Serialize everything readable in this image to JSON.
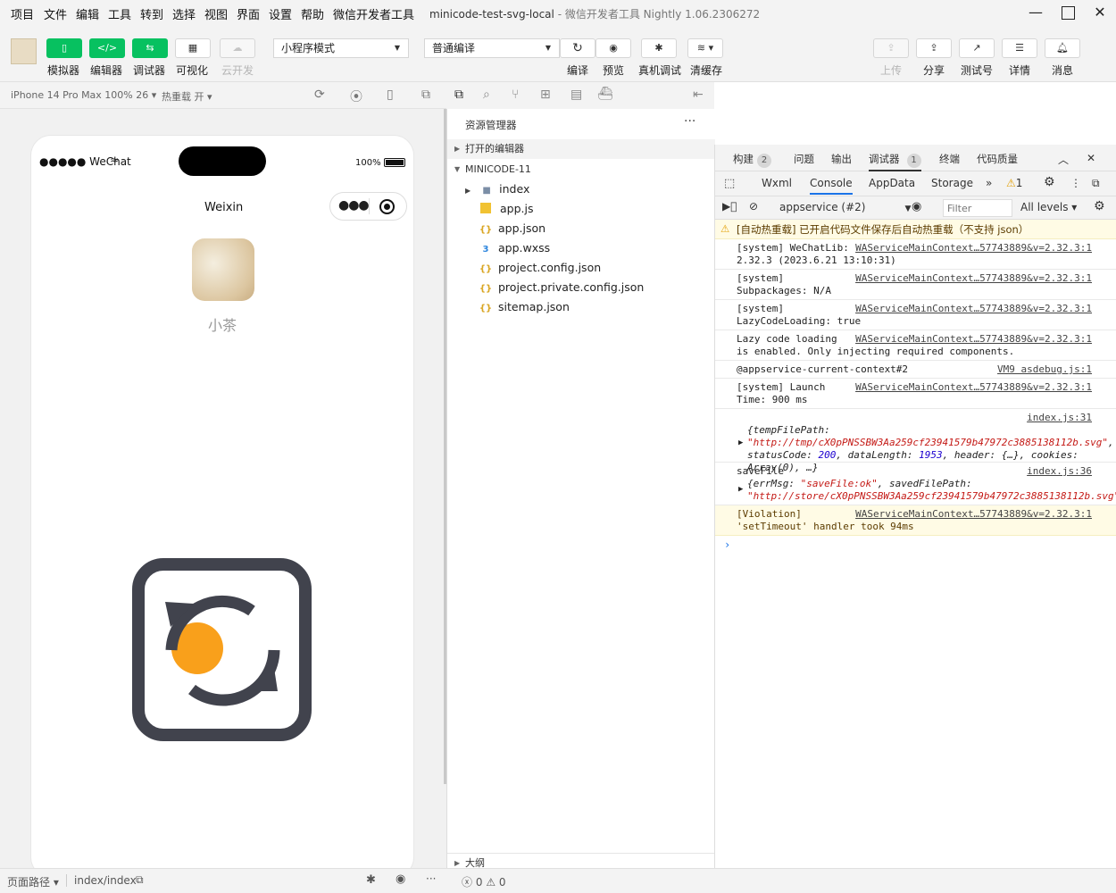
{
  "menubar": {
    "items": [
      "项目",
      "文件",
      "编辑",
      "工具",
      "转到",
      "选择",
      "视图",
      "界面",
      "设置",
      "帮助",
      "微信开发者工具"
    ],
    "window_title": "minicode-test-svg-local",
    "app_name": "微信开发者工具 Nightly 1.06.2306272"
  },
  "toolbar": {
    "simulator": "模拟器",
    "editor": "编辑器",
    "debugger": "调试器",
    "visual": "可视化",
    "cloud": "云开发",
    "mode": "小程序模式",
    "compile_mode": "普通编译",
    "compile": "编译",
    "preview": "预览",
    "real_debug": "真机调试",
    "clear_cache": "清缓存",
    "upload": "上传",
    "share": "分享",
    "test_account": "测试号",
    "details": "详情",
    "messages": "消息"
  },
  "sim": {
    "device": "iPhone 14 Pro Max 100% 26",
    "hot_reload": "热重载 开",
    "carrier": "●●●●● WeChat",
    "battery": "100%",
    "nav_title": "Weixin",
    "nickname": "小茶"
  },
  "explorer": {
    "title": "资源管理器",
    "open_editors": "打开的编辑器",
    "project": "MINICODE-11",
    "outline": "大纲",
    "files": [
      {
        "name": "index",
        "type": "folder"
      },
      {
        "name": "app.js",
        "type": "js"
      },
      {
        "name": "app.json",
        "type": "json"
      },
      {
        "name": "app.wxss",
        "type": "css"
      },
      {
        "name": "project.config.json",
        "type": "json"
      },
      {
        "name": "project.private.config.json",
        "type": "json"
      },
      {
        "name": "sitemap.json",
        "type": "json"
      }
    ],
    "errors": "0",
    "warnings": "0"
  },
  "devtools": {
    "top_tabs": [
      {
        "label": "构建",
        "badge": "2"
      },
      {
        "label": "问题"
      },
      {
        "label": "输出"
      },
      {
        "label": "调试器",
        "badge": "1"
      },
      {
        "label": "终端"
      },
      {
        "label": "代码质量"
      }
    ],
    "panel_tabs": [
      "Wxml",
      "Console",
      "AppData",
      "Storage"
    ],
    "warn_count": "1",
    "context": "appservice (#2)",
    "filter_placeholder": "Filter",
    "levels": "All levels",
    "msgs": {
      "m0": "[自动热重载] 已开启代码文件保存后自动热重载（不支持 json）",
      "m1": "[system] WeChatLib:\n2.32.3 (2023.6.21 13:10:31)",
      "m2": "[system]\nSubpackages: N/A",
      "m3": "[system]\nLazyCodeLoading: true",
      "m4": "Lazy code loading\nis enabled. Only injecting required components.",
      "m5": "@appservice-current-context#2",
      "m6": "[system] Launch\nTime: 900 ms",
      "m9": "[Violation]\n'setTimeout' handler took 94ms",
      "src_wa": "WAServiceMainContext…57743889&v=2.32.3:1",
      "src_vm": "VM9 asdebug.js:1",
      "src_i31": "index.js:31",
      "src_i36": "index.js:36",
      "savefile": "saveFile"
    }
  },
  "status": {
    "page_path": "页面路径",
    "path": "index/index"
  }
}
